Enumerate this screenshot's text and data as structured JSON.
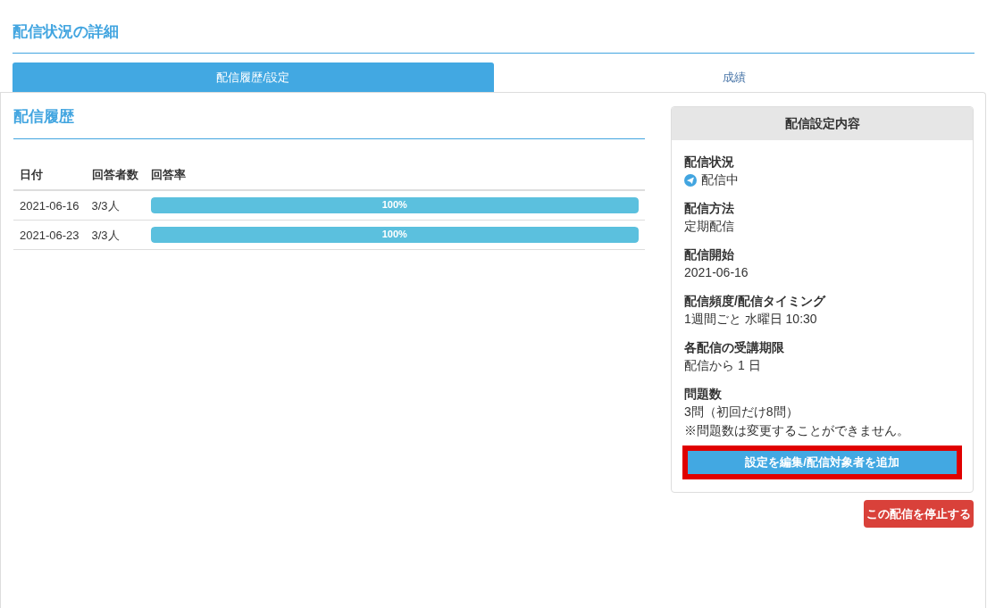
{
  "page_title": "配信状況の詳細",
  "tabs": [
    {
      "label": "配信履歴/設定",
      "selected": true
    },
    {
      "label": "成績",
      "selected": false
    }
  ],
  "history": {
    "title": "配信履歴",
    "table": {
      "columns": [
        "日付",
        "回答者数",
        "回答率"
      ],
      "rows": [
        {
          "date": "2021-06-16",
          "respondents": "3/3人",
          "rate": {
            "level": 1,
            "label": "100%"
          }
        },
        {
          "date": "2021-06-23",
          "respondents": "3/3人",
          "rate": {
            "level": 1,
            "label": "100%"
          }
        }
      ]
    }
  },
  "settings_card": {
    "title": "配信設定内容",
    "items": [
      {
        "kind": "status",
        "label": "配信状況",
        "lines": [
          "配信中"
        ]
      },
      {
        "kind": "text",
        "label": "配信方法",
        "lines": [
          "定期配信"
        ]
      },
      {
        "kind": "text",
        "label": "配信開始",
        "lines": [
          "2021-06-16"
        ]
      },
      {
        "kind": "text",
        "label": "配信頻度/配信タイミング",
        "lines": [
          "1週間ごと 水曜日 10:30"
        ]
      },
      {
        "kind": "text",
        "label": "各配信の受講期限",
        "lines": [
          "配信から 1 日"
        ]
      },
      {
        "kind": "text",
        "label": "問題数",
        "lines": [
          "3問（初回だけ8問）",
          "※問題数は変更することができません。"
        ]
      }
    ],
    "edit_button": {
      "label": "設定を編集/配信対象者を追加",
      "highlighted": true
    }
  },
  "stop_button": {
    "label": "この配信を停止する"
  }
}
